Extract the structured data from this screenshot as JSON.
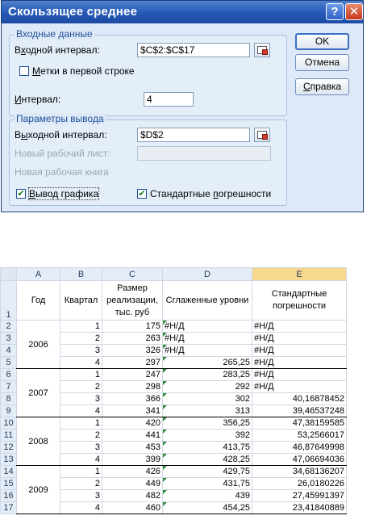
{
  "dialog": {
    "title": "Скользящее среднее",
    "help_glyph": "?",
    "close_glyph": "✕",
    "input_group": {
      "legend": "Входные данные",
      "input_range_label_pre": "В",
      "input_range_label_u": "х",
      "input_range_label_post": "одной интервал:",
      "input_range_value": "$C$2:$C$17",
      "labels_first_row_pre": "",
      "labels_first_row_u": "М",
      "labels_first_row_post": "етки в первой строке",
      "labels_first_row_checked": false,
      "interval_label_pre": "",
      "interval_label_u": "И",
      "interval_label_post": "нтервал:",
      "interval_value": "4"
    },
    "output_group": {
      "legend": "Параметры вывода",
      "output_range_label_pre": "В",
      "output_range_label_u": "ы",
      "output_range_label_post": "ходной интервал:",
      "output_range_value": "$D$2",
      "new_sheet_label": "Новый рабочий лист:",
      "new_workbook_label": "Новая рабочая книга",
      "chart_output_pre": "",
      "chart_output_u": "В",
      "chart_output_post": "ывод графика",
      "chart_output_checked": true,
      "std_errors_pre": "Стандартные ",
      "std_errors_u": "п",
      "std_errors_post": "огрешности",
      "std_errors_checked": true
    },
    "buttons": {
      "ok": "OK",
      "cancel": "Отмена",
      "help_pre": "",
      "help_u": "С",
      "help_post": "правка"
    }
  },
  "sheet": {
    "columns": [
      "A",
      "B",
      "C",
      "D",
      "E"
    ],
    "header_row": {
      "row_num": "1",
      "year": "Год",
      "quarter": "Квартал",
      "sales": "Размер реализации, тыс. руб",
      "smoothed": "Сглаженные уровни",
      "errors": "Стандартные погрешности"
    },
    "years": [
      "2006",
      "2007",
      "2008",
      "2009"
    ],
    "rows": [
      {
        "n": "2",
        "q": "1",
        "c": "175",
        "d": "#Н/Д",
        "e": "#Н/Д"
      },
      {
        "n": "3",
        "q": "2",
        "c": "263",
        "d": "#Н/Д",
        "e": "#Н/Д"
      },
      {
        "n": "4",
        "q": "3",
        "c": "326",
        "d": "#Н/Д",
        "e": "#Н/Д"
      },
      {
        "n": "5",
        "q": "4",
        "c": "297",
        "d": "265,25",
        "e": "#Н/Д"
      },
      {
        "n": "6",
        "q": "1",
        "c": "247",
        "d": "283,25",
        "e": "#Н/Д"
      },
      {
        "n": "7",
        "q": "2",
        "c": "298",
        "d": "292",
        "e": "#Н/Д"
      },
      {
        "n": "8",
        "q": "3",
        "c": "366",
        "d": "302",
        "e": "40,16878452"
      },
      {
        "n": "9",
        "q": "4",
        "c": "341",
        "d": "313",
        "e": "39,46537248"
      },
      {
        "n": "10",
        "q": "1",
        "c": "420",
        "d": "356,25",
        "e": "47,38159585"
      },
      {
        "n": "11",
        "q": "2",
        "c": "441",
        "d": "392",
        "e": "53,2566017"
      },
      {
        "n": "12",
        "q": "3",
        "c": "453",
        "d": "413,75",
        "e": "46,87649998"
      },
      {
        "n": "13",
        "q": "4",
        "c": "399",
        "d": "428,25",
        "e": "47,06694036"
      },
      {
        "n": "14",
        "q": "1",
        "c": "426",
        "d": "429,75",
        "e": "34,68136207"
      },
      {
        "n": "15",
        "q": "2",
        "c": "449",
        "d": "431,75",
        "e": "26,0180226"
      },
      {
        "n": "16",
        "q": "3",
        "c": "482",
        "d": "439",
        "e": "27,45991397"
      },
      {
        "n": "17",
        "q": "4",
        "c": "460",
        "d": "454,25",
        "e": "23,41840889"
      }
    ]
  }
}
